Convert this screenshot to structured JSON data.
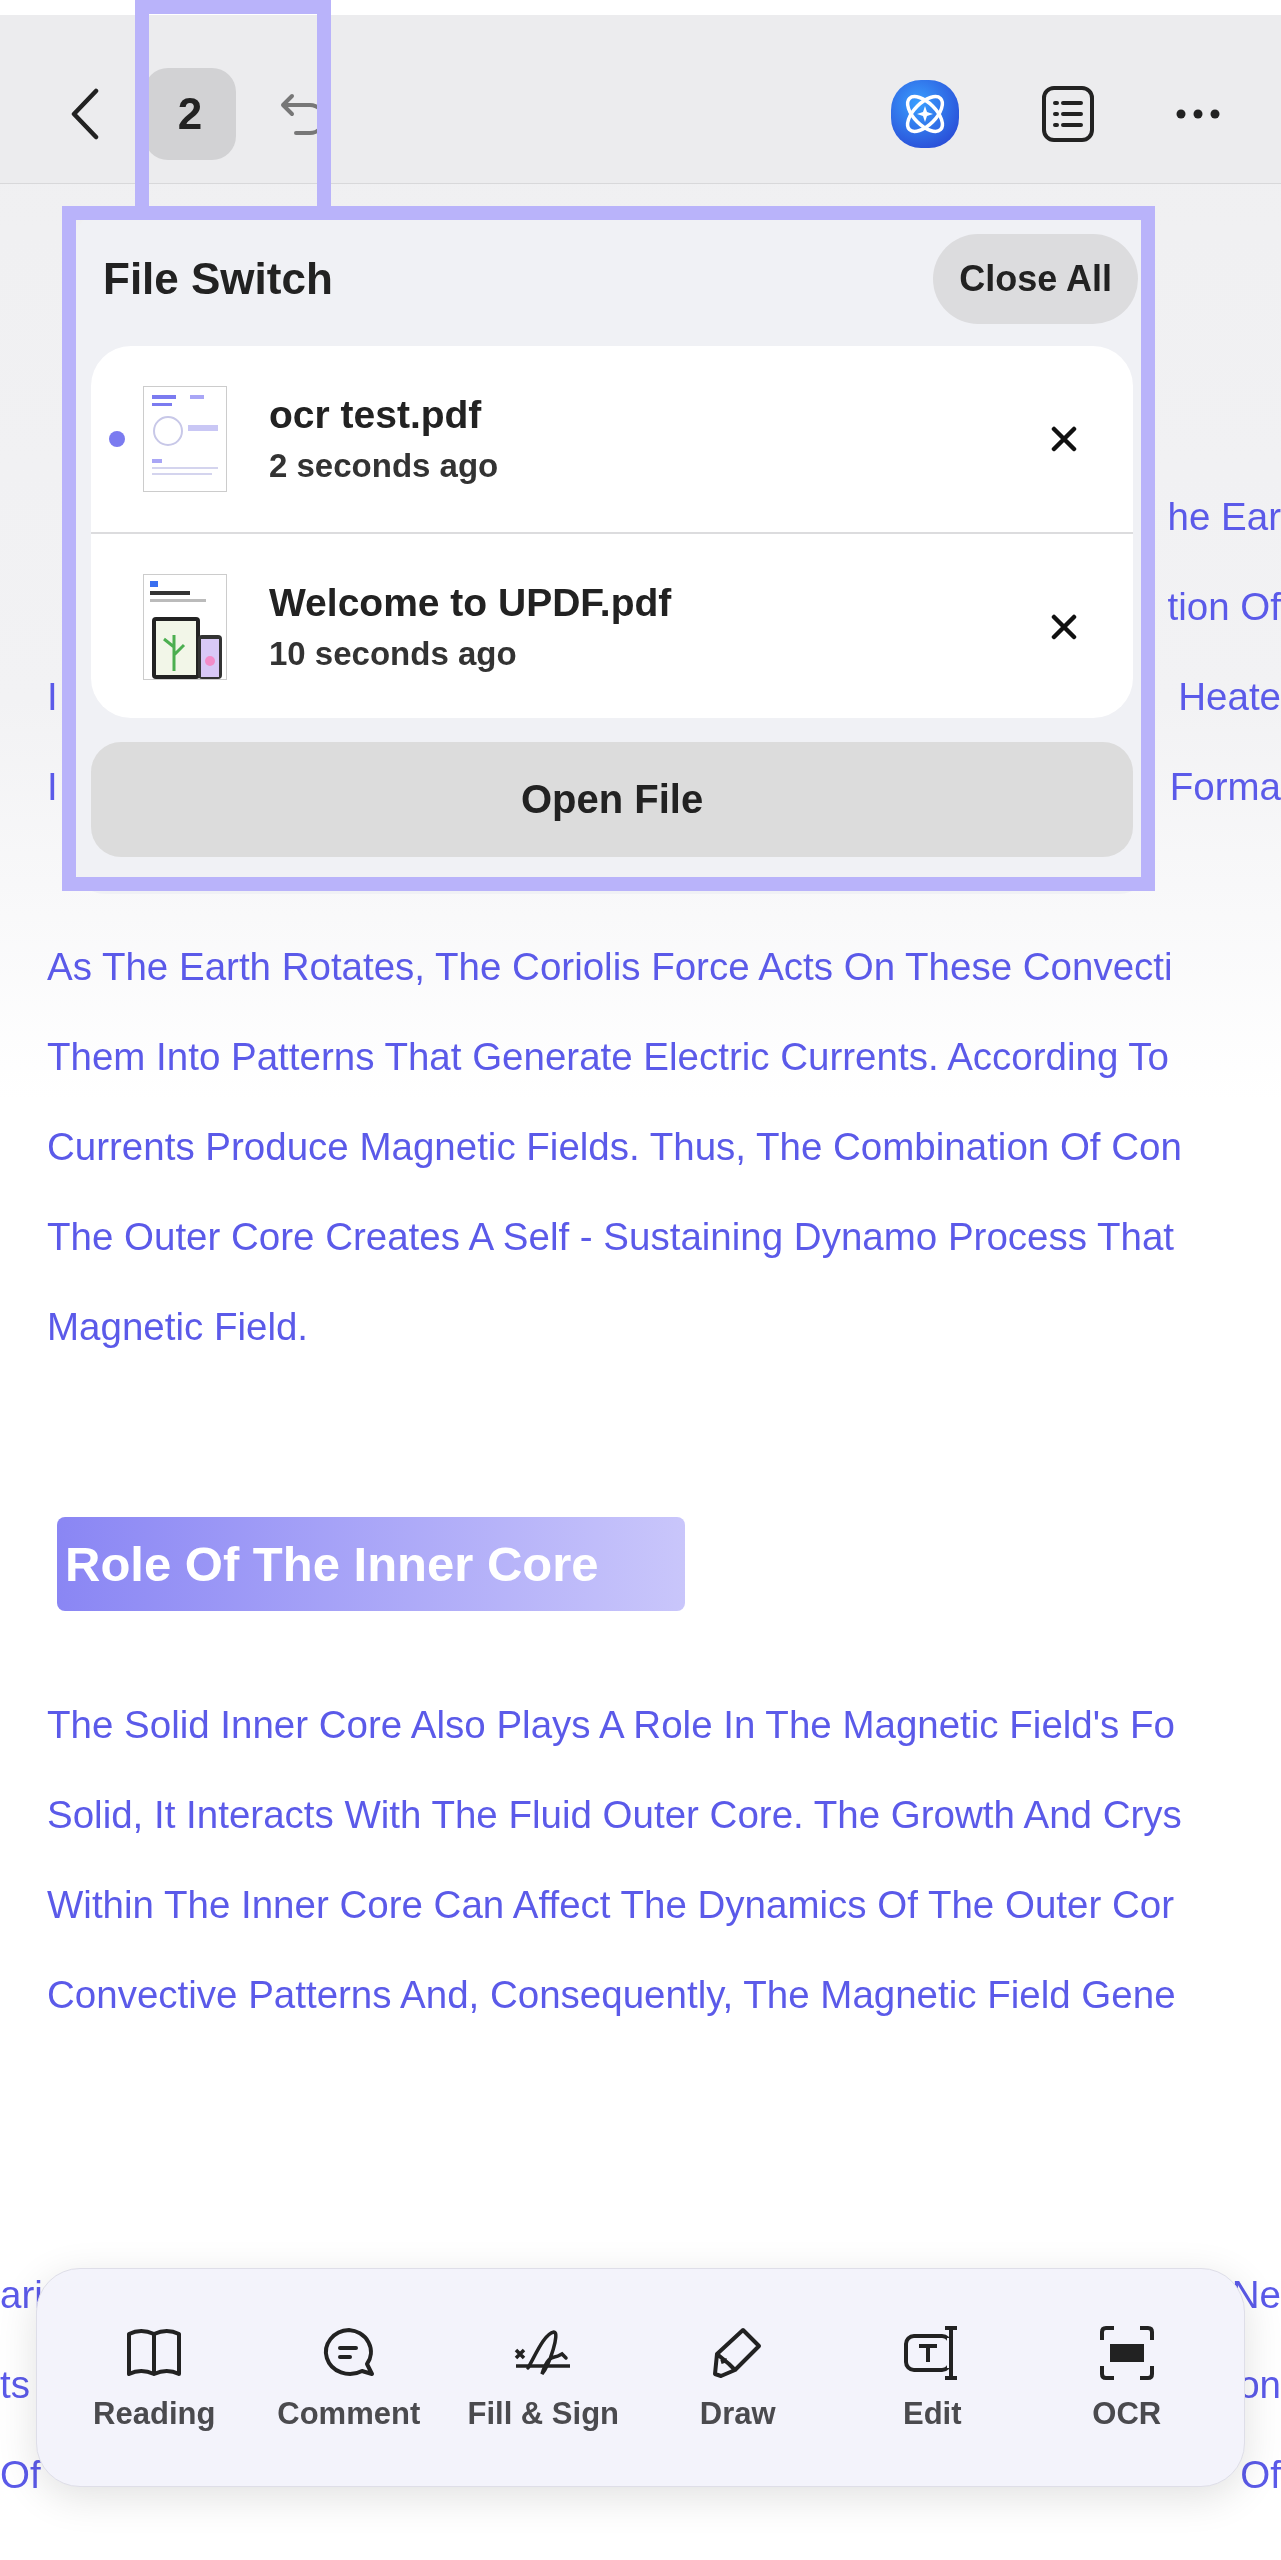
{
  "top_bar": {
    "file_count": "2",
    "file_count_highlighted": true
  },
  "file_switch": {
    "title": "File Switch",
    "close_all": "Close All",
    "highlighted": true,
    "files": [
      {
        "name": "ocr test.pdf",
        "time": "2 seconds ago",
        "selected": true
      },
      {
        "name": "Welcome to UPDF.pdf",
        "time": "10 seconds ago",
        "selected": false
      }
    ],
    "open_file": "Open File"
  },
  "document": {
    "partial_rows": [
      {
        "right": "he Ear"
      },
      {
        "right": "tion Of"
      },
      {
        "left": "I",
        "right": "Heate"
      },
      {
        "left": "I",
        "right": "Forma"
      }
    ],
    "paragraph_1": [
      "As The Earth Rotates, The Coriolis Force Acts On These Convecti",
      "Them Into Patterns That Generate Electric Currents. According To",
      "Currents Produce Magnetic Fields. Thus, The Combination Of Con",
      "The Outer Core Creates A Self - Sustaining Dynamo Process That",
      "Magnetic Field."
    ],
    "heading": "Role Of The Inner Core",
    "paragraph_2": [
      "The Solid Inner Core Also Plays A Role In The Magnetic Field's Fo",
      "Solid, It Interacts With The Fluid Outer Core. The Growth And Crys",
      "Within The Inner Core Can Affect The Dynamics Of The Outer Cor",
      "Convective Patterns And, Consequently, The Magnetic Field Gene"
    ],
    "bottom_rows": [
      {
        "left": "ari",
        "right": "Ne"
      },
      {
        "left": "ts",
        "right": "on"
      },
      {
        "left": "Of",
        "right": "Of"
      }
    ]
  },
  "bottom_toolbar": [
    {
      "label": "Reading"
    },
    {
      "label": "Comment"
    },
    {
      "label": "Fill & Sign"
    },
    {
      "label": "Draw"
    },
    {
      "label": "Edit"
    },
    {
      "label": "OCR"
    }
  ]
}
